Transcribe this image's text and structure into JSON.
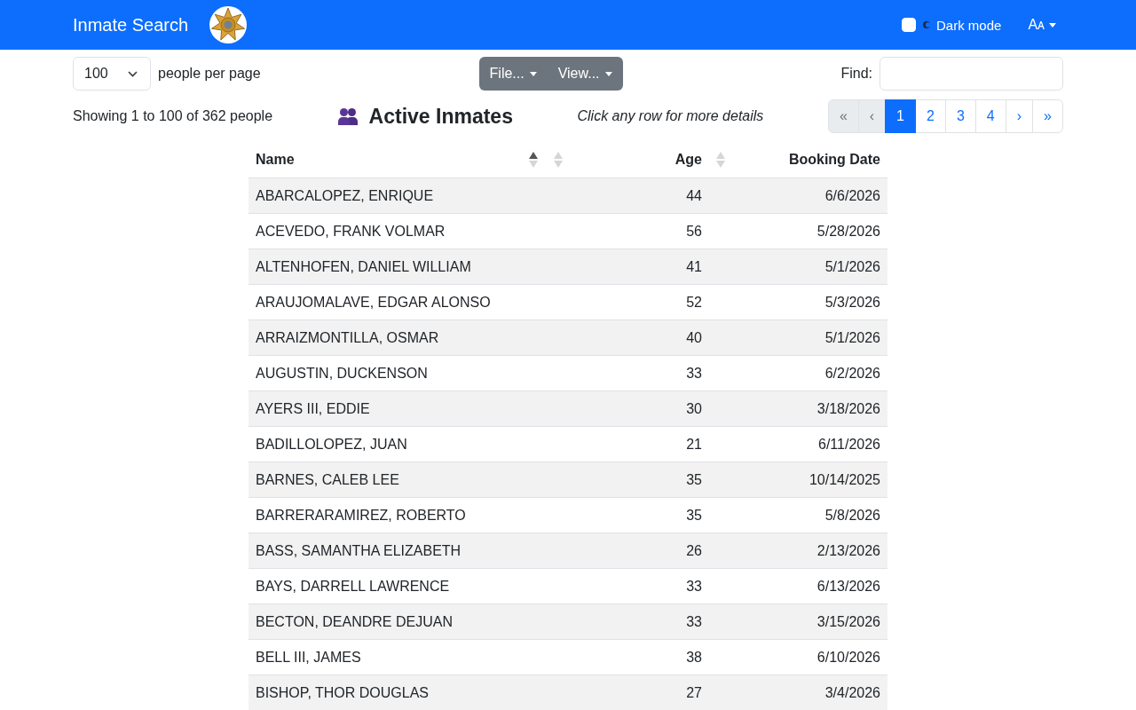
{
  "navbar": {
    "title": "Inmate Search",
    "dark_mode": {
      "label": "Dark mode",
      "checked": false
    },
    "font_menu": {
      "label": "Aᴀ"
    }
  },
  "toolbar": {
    "page_size": {
      "value": "100",
      "label": "people per page"
    },
    "menus": [
      {
        "label": "File..."
      },
      {
        "label": "View..."
      }
    ],
    "find": {
      "label": "Find:"
    }
  },
  "summary": "Showing 1 to 100 of 362 people",
  "heading": "Active Inmates",
  "hint": "Click any row for more details",
  "pagination": [
    {
      "label": "«",
      "selected": false,
      "disabled": true
    },
    {
      "label": "‹",
      "selected": false,
      "disabled": true
    },
    {
      "label": "1",
      "selected": true,
      "disabled": false
    },
    {
      "label": "2",
      "selected": false,
      "disabled": false
    },
    {
      "label": "3",
      "selected": false,
      "disabled": false
    },
    {
      "label": "4",
      "selected": false,
      "disabled": false
    },
    {
      "label": "›",
      "selected": false,
      "disabled": false
    },
    {
      "label": "»",
      "selected": false,
      "disabled": false
    }
  ],
  "table": {
    "columns": [
      {
        "kind": "text",
        "label": "Name",
        "sortable": true,
        "sorted": true
      },
      {
        "kind": "blank",
        "sortable": true,
        "sorted": false
      },
      {
        "kind": "number",
        "label": "Age",
        "sortable": true,
        "sorted": false
      },
      {
        "kind": "date",
        "label": "Booking Date"
      }
    ],
    "rows": [
      [
        "ABARCALOPEZ, ENRIQUE",
        "",
        "44",
        "6/6/2026"
      ],
      [
        "ACEVEDO, FRANK VOLMAR",
        "",
        "56",
        "5/28/2026"
      ],
      [
        "ALTENHOFEN, DANIEL WILLIAM",
        "",
        "41",
        "5/1/2026"
      ],
      [
        "ARAUJOMALAVE, EDGAR ALONSO",
        "",
        "52",
        "5/3/2026"
      ],
      [
        "ARRAIZMONTILLA, OSMAR",
        "",
        "40",
        "5/1/2026"
      ],
      [
        "AUGUSTIN, DUCKENSON",
        "",
        "33",
        "6/2/2026"
      ],
      [
        "AYERS III, EDDIE",
        "",
        "30",
        "3/18/2026"
      ],
      [
        "BADILLOLOPEZ, JUAN",
        "",
        "21",
        "6/11/2026"
      ],
      [
        "BARNES, CALEB LEE",
        "",
        "35",
        "10/14/2025"
      ],
      [
        "BARRERARAMIREZ, ROBERTO",
        "",
        "35",
        "5/8/2026"
      ],
      [
        "BASS, SAMANTHA ELIZABETH",
        "",
        "26",
        "2/13/2026"
      ],
      [
        "BAYS, DARRELL LAWRENCE",
        "",
        "33",
        "6/13/2026"
      ],
      [
        "BECTON, DEANDRE DEJUAN",
        "",
        "33",
        "3/15/2026"
      ],
      [
        "BELL III, JAMES",
        "",
        "38",
        "6/10/2026"
      ],
      [
        "BISHOP, THOR DOUGLAS",
        "",
        "27",
        "3/4/2026"
      ]
    ]
  }
}
